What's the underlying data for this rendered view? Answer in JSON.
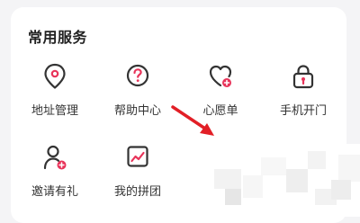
{
  "section": {
    "title": "常用服务"
  },
  "items": [
    {
      "label": "地址管理",
      "icon": "location-pin-icon"
    },
    {
      "label": "帮助中心",
      "icon": "help-question-icon"
    },
    {
      "label": "心愿单",
      "icon": "wishlist-heart-icon"
    },
    {
      "label": "手机开门",
      "icon": "lock-door-icon"
    },
    {
      "label": "邀请有礼",
      "icon": "invite-user-icon"
    },
    {
      "label": "我的拼团",
      "icon": "group-buy-chart-icon"
    },
    {
      "label": "",
      "icon": "partial-hidden-icon"
    }
  ],
  "colors": {
    "accent": "#e8345a",
    "icon_stroke": "#333333",
    "card_bg": "#ffffff",
    "page_bg": "#f4f4f6",
    "annotation_arrow": "#e21f26"
  }
}
